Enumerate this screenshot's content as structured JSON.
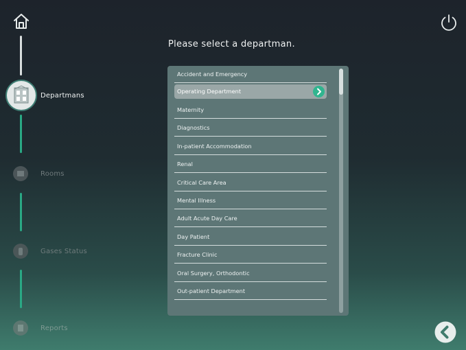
{
  "title": "Please select a departman.",
  "steps": [
    {
      "label": "Departmans",
      "state": "active"
    },
    {
      "label": "Rooms",
      "state": "inactive"
    },
    {
      "label": "Gases Status",
      "state": "inactive"
    },
    {
      "label": "Reports",
      "state": "inactive"
    }
  ],
  "departments": [
    "Accident and Emergency",
    "Operating Department",
    "Maternity",
    "Diagnostics",
    "In-patient Accommodation",
    "Renal",
    "Critical Care Area",
    "Mental Illness",
    "Adult Acute Day Care",
    "Day Patient",
    "Fracture Clinic",
    "Oral Surgery, Orthodontic",
    "Out-patient Department"
  ],
  "selected_department": "Operating Department",
  "icons": {
    "home": "home-icon",
    "power": "power-icon",
    "back": "back-arrow-icon",
    "selected": "chevron-right-icon"
  },
  "colors": {
    "accent": "#30b58f",
    "panel": "#5d7676",
    "selected_row": "#9aa7a7"
  }
}
